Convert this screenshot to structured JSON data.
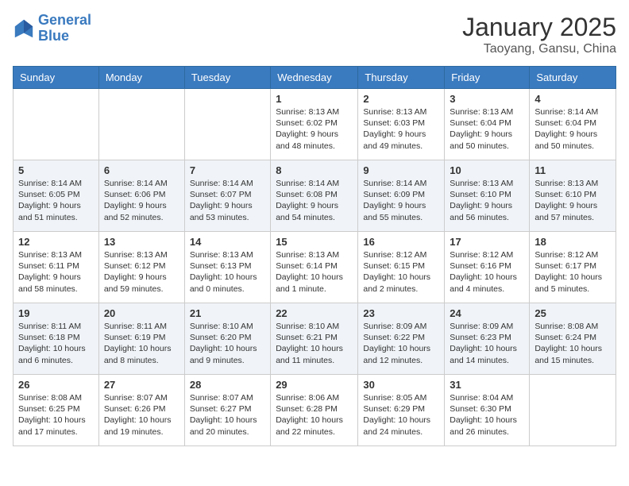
{
  "header": {
    "logo_general": "General",
    "logo_blue": "Blue",
    "month": "January 2025",
    "location": "Taoyang, Gansu, China"
  },
  "days_of_week": [
    "Sunday",
    "Monday",
    "Tuesday",
    "Wednesday",
    "Thursday",
    "Friday",
    "Saturday"
  ],
  "weeks": [
    [
      {
        "day": "",
        "info": ""
      },
      {
        "day": "",
        "info": ""
      },
      {
        "day": "",
        "info": ""
      },
      {
        "day": "1",
        "info": "Sunrise: 8:13 AM\nSunset: 6:02 PM\nDaylight: 9 hours\nand 48 minutes."
      },
      {
        "day": "2",
        "info": "Sunrise: 8:13 AM\nSunset: 6:03 PM\nDaylight: 9 hours\nand 49 minutes."
      },
      {
        "day": "3",
        "info": "Sunrise: 8:13 AM\nSunset: 6:04 PM\nDaylight: 9 hours\nand 50 minutes."
      },
      {
        "day": "4",
        "info": "Sunrise: 8:14 AM\nSunset: 6:04 PM\nDaylight: 9 hours\nand 50 minutes."
      }
    ],
    [
      {
        "day": "5",
        "info": "Sunrise: 8:14 AM\nSunset: 6:05 PM\nDaylight: 9 hours\nand 51 minutes."
      },
      {
        "day": "6",
        "info": "Sunrise: 8:14 AM\nSunset: 6:06 PM\nDaylight: 9 hours\nand 52 minutes."
      },
      {
        "day": "7",
        "info": "Sunrise: 8:14 AM\nSunset: 6:07 PM\nDaylight: 9 hours\nand 53 minutes."
      },
      {
        "day": "8",
        "info": "Sunrise: 8:14 AM\nSunset: 6:08 PM\nDaylight: 9 hours\nand 54 minutes."
      },
      {
        "day": "9",
        "info": "Sunrise: 8:14 AM\nSunset: 6:09 PM\nDaylight: 9 hours\nand 55 minutes."
      },
      {
        "day": "10",
        "info": "Sunrise: 8:13 AM\nSunset: 6:10 PM\nDaylight: 9 hours\nand 56 minutes."
      },
      {
        "day": "11",
        "info": "Sunrise: 8:13 AM\nSunset: 6:10 PM\nDaylight: 9 hours\nand 57 minutes."
      }
    ],
    [
      {
        "day": "12",
        "info": "Sunrise: 8:13 AM\nSunset: 6:11 PM\nDaylight: 9 hours\nand 58 minutes."
      },
      {
        "day": "13",
        "info": "Sunrise: 8:13 AM\nSunset: 6:12 PM\nDaylight: 9 hours\nand 59 minutes."
      },
      {
        "day": "14",
        "info": "Sunrise: 8:13 AM\nSunset: 6:13 PM\nDaylight: 10 hours\nand 0 minutes."
      },
      {
        "day": "15",
        "info": "Sunrise: 8:13 AM\nSunset: 6:14 PM\nDaylight: 10 hours\nand 1 minute."
      },
      {
        "day": "16",
        "info": "Sunrise: 8:12 AM\nSunset: 6:15 PM\nDaylight: 10 hours\nand 2 minutes."
      },
      {
        "day": "17",
        "info": "Sunrise: 8:12 AM\nSunset: 6:16 PM\nDaylight: 10 hours\nand 4 minutes."
      },
      {
        "day": "18",
        "info": "Sunrise: 8:12 AM\nSunset: 6:17 PM\nDaylight: 10 hours\nand 5 minutes."
      }
    ],
    [
      {
        "day": "19",
        "info": "Sunrise: 8:11 AM\nSunset: 6:18 PM\nDaylight: 10 hours\nand 6 minutes."
      },
      {
        "day": "20",
        "info": "Sunrise: 8:11 AM\nSunset: 6:19 PM\nDaylight: 10 hours\nand 8 minutes."
      },
      {
        "day": "21",
        "info": "Sunrise: 8:10 AM\nSunset: 6:20 PM\nDaylight: 10 hours\nand 9 minutes."
      },
      {
        "day": "22",
        "info": "Sunrise: 8:10 AM\nSunset: 6:21 PM\nDaylight: 10 hours\nand 11 minutes."
      },
      {
        "day": "23",
        "info": "Sunrise: 8:09 AM\nSunset: 6:22 PM\nDaylight: 10 hours\nand 12 minutes."
      },
      {
        "day": "24",
        "info": "Sunrise: 8:09 AM\nSunset: 6:23 PM\nDaylight: 10 hours\nand 14 minutes."
      },
      {
        "day": "25",
        "info": "Sunrise: 8:08 AM\nSunset: 6:24 PM\nDaylight: 10 hours\nand 15 minutes."
      }
    ],
    [
      {
        "day": "26",
        "info": "Sunrise: 8:08 AM\nSunset: 6:25 PM\nDaylight: 10 hours\nand 17 minutes."
      },
      {
        "day": "27",
        "info": "Sunrise: 8:07 AM\nSunset: 6:26 PM\nDaylight: 10 hours\nand 19 minutes."
      },
      {
        "day": "28",
        "info": "Sunrise: 8:07 AM\nSunset: 6:27 PM\nDaylight: 10 hours\nand 20 minutes."
      },
      {
        "day": "29",
        "info": "Sunrise: 8:06 AM\nSunset: 6:28 PM\nDaylight: 10 hours\nand 22 minutes."
      },
      {
        "day": "30",
        "info": "Sunrise: 8:05 AM\nSunset: 6:29 PM\nDaylight: 10 hours\nand 24 minutes."
      },
      {
        "day": "31",
        "info": "Sunrise: 8:04 AM\nSunset: 6:30 PM\nDaylight: 10 hours\nand 26 minutes."
      },
      {
        "day": "",
        "info": ""
      }
    ]
  ]
}
